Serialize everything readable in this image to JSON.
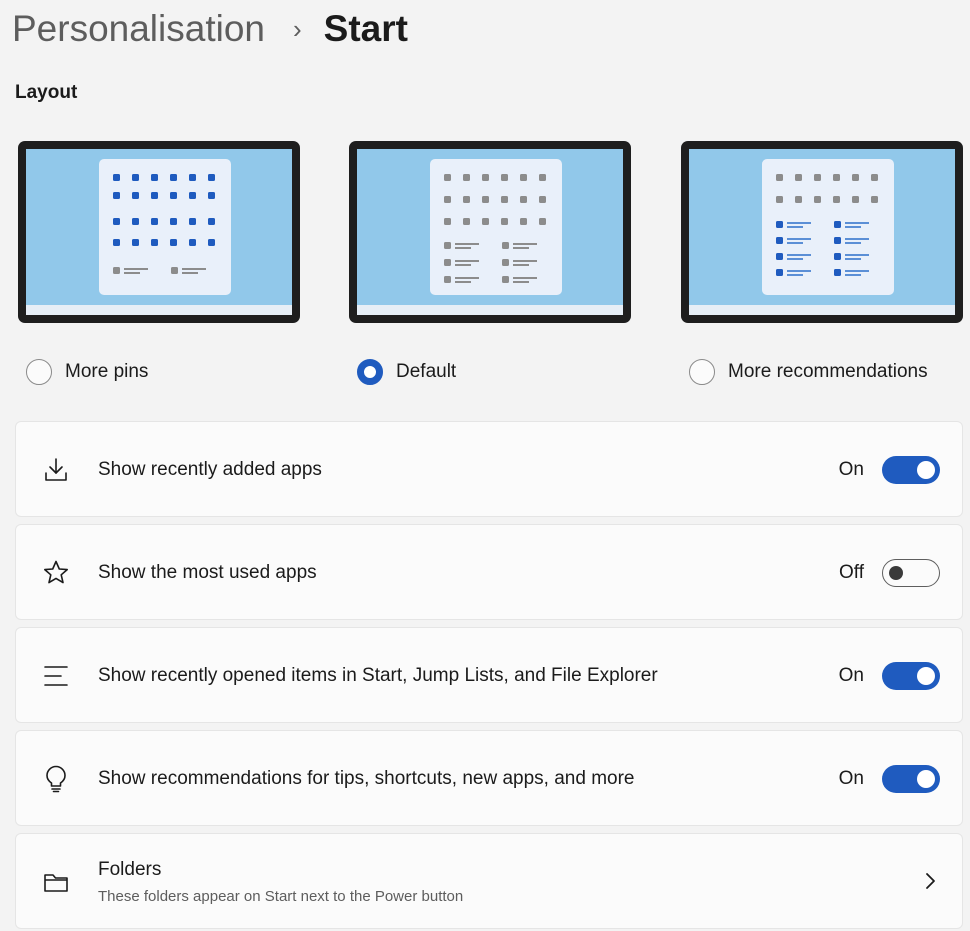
{
  "breadcrumb": {
    "parent": "Personalisation",
    "separator": "›",
    "current": "Start"
  },
  "layout": {
    "title": "Layout",
    "options": [
      {
        "label": "More pins",
        "selected": false
      },
      {
        "label": "Default",
        "selected": true
      },
      {
        "label": "More recommendations",
        "selected": false
      }
    ]
  },
  "settings": [
    {
      "label": "Show recently added apps",
      "state": "On",
      "enabled": true,
      "icon": "download-icon"
    },
    {
      "label": "Show the most used apps",
      "state": "Off",
      "enabled": false,
      "icon": "star-icon"
    },
    {
      "label": "Show recently opened items in Start, Jump Lists, and File Explorer",
      "state": "On",
      "enabled": true,
      "icon": "list-lines-icon"
    },
    {
      "label": "Show recommendations for tips, shortcuts, new apps, and more",
      "state": "On",
      "enabled": true,
      "icon": "lightbulb-icon"
    }
  ],
  "folders": {
    "title": "Folders",
    "subtitle": "These folders appear on Start next to the Power button",
    "icon": "folder-icon"
  },
  "colors": {
    "accent": "#1f5bbf",
    "background": "#f3f3f3",
    "card": "#fbfbfb",
    "preview_sky": "#91c8ea"
  }
}
